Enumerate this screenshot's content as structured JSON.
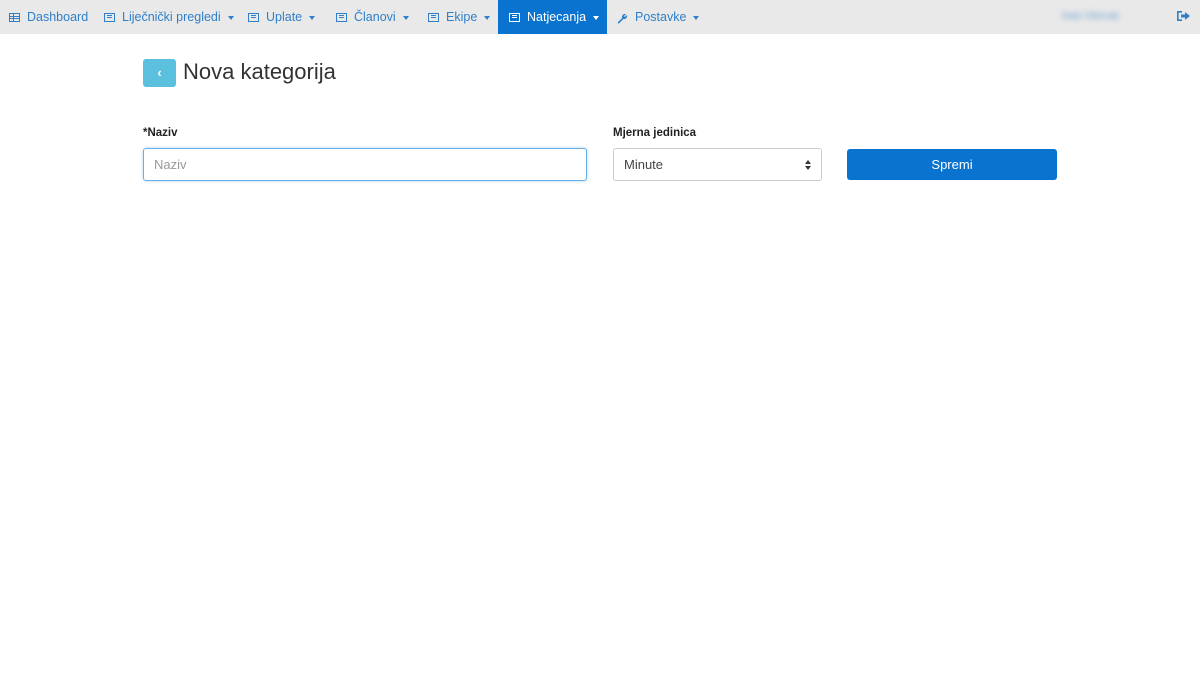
{
  "nav": {
    "items": [
      {
        "label": "Dashboard",
        "icon": "table-icon",
        "dropdown": false
      },
      {
        "label": "Liječnički pregledi",
        "icon": "list-icon",
        "dropdown": true
      },
      {
        "label": "Uplate",
        "icon": "list-icon",
        "dropdown": true
      },
      {
        "label": "Članovi",
        "icon": "list-icon",
        "dropdown": true
      },
      {
        "label": "Ekipe",
        "icon": "list-icon",
        "dropdown": true
      },
      {
        "label": "Natjecanja",
        "icon": "list-icon",
        "dropdown": true,
        "active": true
      },
      {
        "label": "Postavke",
        "icon": "wrench-icon",
        "dropdown": true
      }
    ],
    "user_name": "Ivan Horvat",
    "logout_icon": "sign-out-icon"
  },
  "page": {
    "title": "Nova kategorija",
    "back_label": "‹"
  },
  "form": {
    "naziv_label": "*Naziv",
    "naziv_placeholder": "Naziv",
    "naziv_value": "",
    "unit_label": "Mjerna jedinica",
    "unit_value": "Minute",
    "save_label": "Spremi"
  },
  "colors": {
    "primary": "#0a73cf",
    "nav_link": "#2f7fc9",
    "back_button": "#5bc0de",
    "navbar_bg": "#e9e9e9"
  }
}
